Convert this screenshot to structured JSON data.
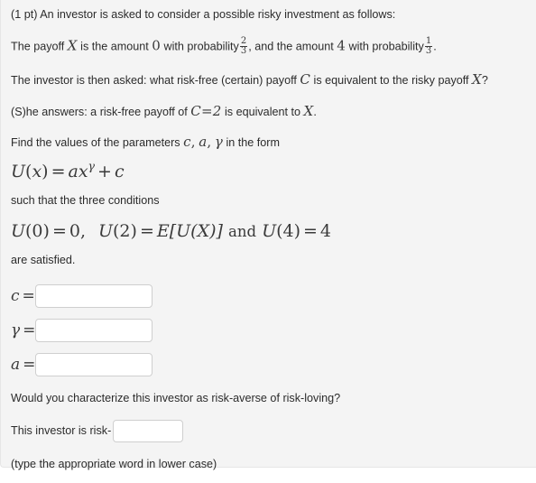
{
  "problem": {
    "points_prefix": "(1 pt)",
    "intro": "An investor is asked to consider a possible risky investment as follows:",
    "line_payoff": {
      "before_var": "The payoff",
      "var_x": "X",
      "mid1": "is the amount",
      "amount_zero": "0",
      "mid2": "with probability",
      "prob1_num": "2",
      "prob1_den": "3",
      "mid3": ", and the amount",
      "amount_four": "4",
      "mid4": "with probability",
      "prob2_num": "1",
      "prob2_den": "3",
      "end": "."
    },
    "line_asked": {
      "before_var": "The investor is then asked: what risk-free (certain) payoff",
      "var_c": "C",
      "mid": "is equivalent to the risky payoff",
      "var_x": "X",
      "end": "?"
    },
    "line_answer": {
      "before": "(S)he answers: a risk-free payoff of",
      "var_c": "C",
      "equals": "=",
      "value": "2",
      "mid": "is equivalent to",
      "var_x": "X",
      "end": "."
    },
    "line_find": {
      "before": "Find the values of the parameters",
      "param_c": "c",
      "comma1": ",",
      "param_a": "a",
      "comma2": ",",
      "param_gamma": "γ",
      "after": "in the form"
    },
    "utility_formula": {
      "lhs_fn": "U",
      "lhs_open": "(",
      "lhs_var": "x",
      "lhs_close": ")",
      "equals": "=",
      "coef": "a",
      "base": "x",
      "exponent": "γ",
      "plus": "+",
      "constant": "c"
    },
    "such_that": "such that the three conditions",
    "conditions": {
      "c1_fn": "U",
      "c1_arg": "(0)",
      "c1_eq": "=",
      "c1_val": "0,",
      "c2_fn": "U",
      "c2_arg": "(2)",
      "c2_eq": "=",
      "c2_rhs_e": "E",
      "c2_rhs_body": "[U(X)]",
      "and": "and",
      "c3_fn": "U",
      "c3_arg": "(4)",
      "c3_eq": "=",
      "c3_val": "4"
    },
    "are_satisfied": "are satisfied."
  },
  "answers": {
    "c": {
      "label_var": "c",
      "label_eq": "=",
      "value": "",
      "placeholder": ""
    },
    "gamma": {
      "label_var": "γ",
      "label_eq": "=",
      "value": "",
      "placeholder": ""
    },
    "a": {
      "label_var": "a",
      "label_eq": "=",
      "value": "",
      "placeholder": ""
    }
  },
  "characterization": {
    "question": "Would you characterize this investor as risk-averse of risk-loving?",
    "prompt": "This investor is risk-",
    "input_value": "",
    "input_placeholder": "",
    "hint": "(type the appropriate word in lower case)"
  },
  "colors": {
    "panel_background": "#f4f4f4",
    "panel_border": "#e6e6e6",
    "body_text": "#2b2b2b",
    "math_text": "#3a3a3a",
    "input_border": "#cfcfcf",
    "input_background": "#ffffff",
    "page_background": "#ffffff"
  }
}
